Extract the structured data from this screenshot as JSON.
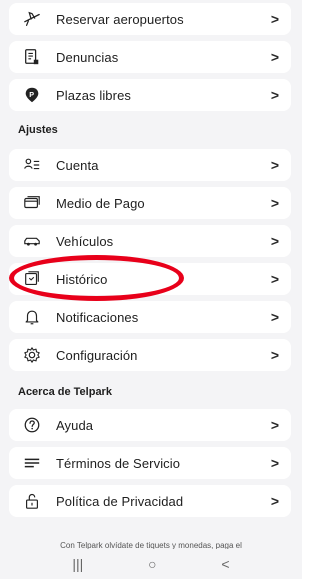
{
  "menu": {
    "top_items": [
      {
        "label": "Reservar aeropuertos",
        "icon": "airplane-icon"
      },
      {
        "label": "Denuncias",
        "icon": "ticket-report-icon"
      },
      {
        "label": "Plazas libres",
        "icon": "parking-pin-icon"
      }
    ],
    "ajustes_title": "Ajustes",
    "ajustes_items": [
      {
        "label": "Cuenta",
        "icon": "account-icon"
      },
      {
        "label": "Medio de Pago",
        "icon": "credit-card-icon"
      },
      {
        "label": "Vehículos",
        "icon": "car-icon"
      },
      {
        "label": "Histórico",
        "icon": "history-icon"
      },
      {
        "label": "Notificaciones",
        "icon": "bell-icon"
      },
      {
        "label": "Configuración",
        "icon": "gear-icon"
      }
    ],
    "about_title": "Acerca de Telpark",
    "about_items": [
      {
        "label": "Ayuda",
        "icon": "help-icon"
      },
      {
        "label": "Términos de Servicio",
        "icon": "terms-icon"
      },
      {
        "label": "Política de Privacidad",
        "icon": "lock-icon"
      }
    ],
    "chevron": ">"
  },
  "footer": {
    "text": "Con Telpark olvídate de tiquets y monedas, paga el"
  },
  "navbar": {
    "recents": "|||",
    "home": "○",
    "back": "<"
  },
  "colors": {
    "highlight": "#e8001a",
    "background": "#f4f4f6"
  }
}
